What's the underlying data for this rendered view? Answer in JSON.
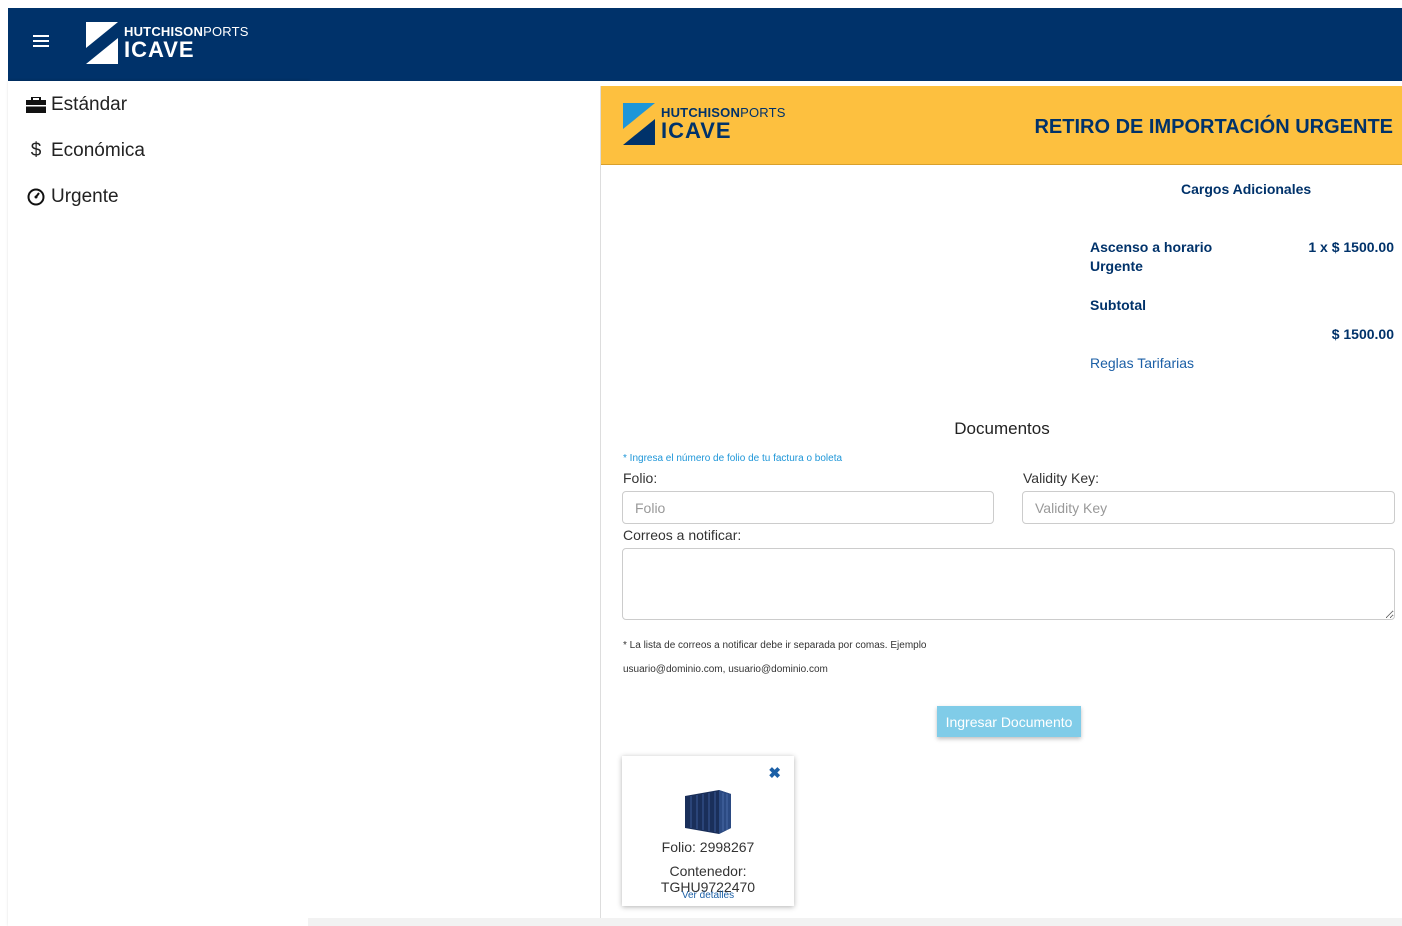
{
  "header": {
    "menu_icon": "hamburger-icon",
    "logo_line1_bold": "HUTCHISON",
    "logo_line1_light": "PORTS",
    "logo_line2": "ICAVE",
    "background": "#00326a"
  },
  "sidebar": {
    "items": [
      {
        "icon": "briefcase-icon",
        "glyph": "💼",
        "label": "Estándar"
      },
      {
        "icon": "dollar-icon",
        "glyph": "$",
        "label": "Económica"
      },
      {
        "icon": "dashboard-icon",
        "glyph": "◔",
        "label": "Urgente"
      }
    ]
  },
  "panel": {
    "header_bg": "#fdc03f",
    "logo_line1_bold": "HUTCHISON",
    "logo_line1_light": "PORTS",
    "logo_line2": "ICAVE",
    "title": "RETIRO DE IMPORTACIÓN URGENTE",
    "cargos": {
      "title": "Cargos Adicionales",
      "item_label": "Ascenso a horario Urgente",
      "item_value": "1 x $ 1500.00",
      "subtotal_label": "Subtotal",
      "subtotal_value": "$ 1500.00",
      "reglas_link": "Reglas Tarifarias"
    },
    "documentos": {
      "title": "Documentos",
      "hint": "* Ingresa el número de folio de tu factura o boleta",
      "folio_label": "Folio:",
      "folio_placeholder": "Folio",
      "validity_label": "Validity Key:",
      "validity_placeholder": "Validity Key",
      "correos_label": "Correos a notificar:",
      "note_line1": "* La lista de correos a notificar debe ir separada por comas. Ejemplo",
      "note_line2": "usuario@dominio.com, usuario@dominio.com",
      "submit_button": "Ingresar Documento"
    },
    "card": {
      "close_icon": "close-icon",
      "container_icon": "shipping-container-icon",
      "folio": "Folio: 2998267",
      "contenedor": "Contenedor: TGHU9722470",
      "ver_detalles": "Ver detalles"
    }
  }
}
